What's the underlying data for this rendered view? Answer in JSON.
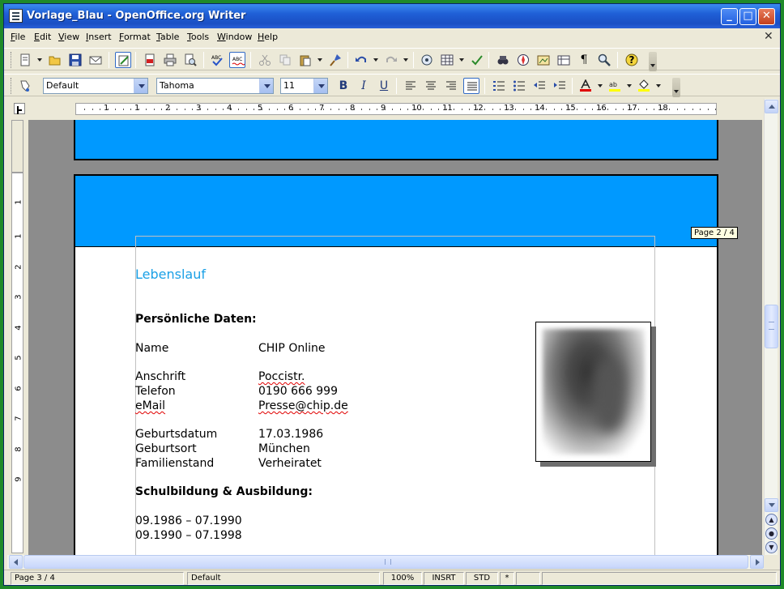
{
  "window": {
    "title": "Vorlage_Blau - OpenOffice.org Writer",
    "min_glyph": "_",
    "max_glyph": "□",
    "close_glyph": "✕",
    "doc_close_glyph": "✕"
  },
  "menu": [
    "File",
    "Edit",
    "View",
    "Insert",
    "Format",
    "Table",
    "Tools",
    "Window",
    "Help"
  ],
  "formatting": {
    "style": "Default",
    "font": "Tahoma",
    "size": "11",
    "bold": "B",
    "italic": "I",
    "underline": "U",
    "pilcrow": "¶",
    "help": "?"
  },
  "ruler": {
    "numbers": [
      "1",
      "1",
      "2",
      "3",
      "4",
      "5",
      "6",
      "7",
      "8",
      "9",
      "10",
      "11",
      "12",
      "13",
      "14",
      "15",
      "16",
      "17",
      "18"
    ],
    "vertical_numbers": [
      "1",
      "1",
      "2",
      "3",
      "4",
      "5",
      "6",
      "7",
      "8",
      "9"
    ]
  },
  "document": {
    "heading": "Lebenslauf",
    "personal_title": "Persönliche Daten:",
    "fields": [
      {
        "label": "Name",
        "value": "CHIP Online"
      },
      {
        "label": "Anschrift",
        "value": "Poccistr."
      },
      {
        "label": "Telefon",
        "value": "0190 666 999"
      },
      {
        "label": "eMail",
        "value": "Presse@chip.de"
      },
      {
        "label": "Geburtsdatum",
        "value": "17.03.1986"
      },
      {
        "label": "Geburtsort",
        "value": "München"
      },
      {
        "label": "Familienstand",
        "value": "Verheiratet"
      }
    ],
    "education_title": "Schulbildung & Ausbildung:",
    "education": [
      "09.1986 – 07.1990",
      "09.1990 – 07.1998"
    ],
    "brand_color": "#0099ff",
    "heading_color": "#1aa0e6"
  },
  "tooltip": "Page 2 / 4",
  "status": {
    "page": "Page 3 / 4",
    "style": "Default",
    "zoom": "100%",
    "insert_mode": "INSRT",
    "selection_mode": "STD",
    "modified": "*"
  }
}
